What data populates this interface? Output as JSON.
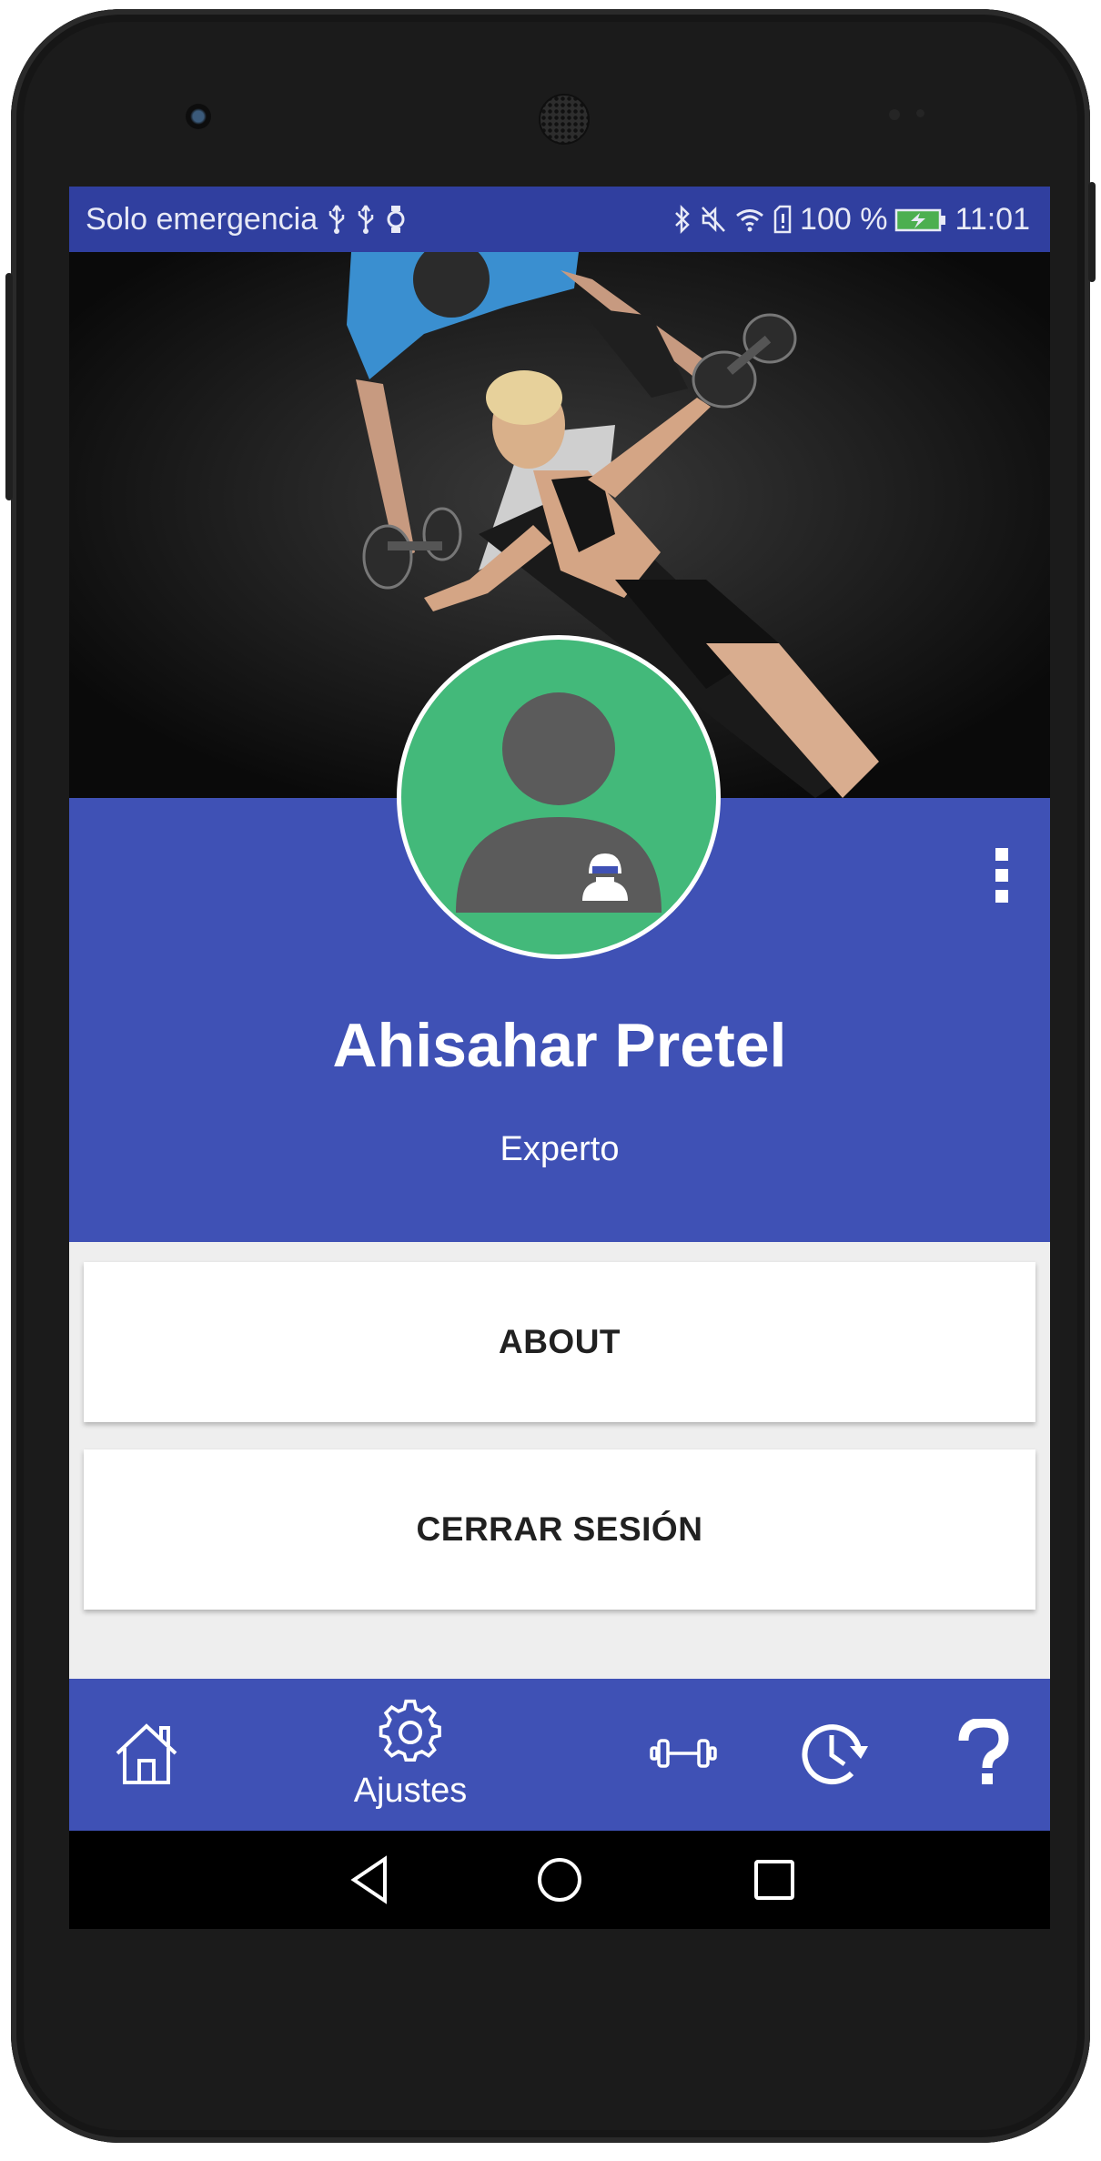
{
  "status_bar": {
    "carrier": "Solo emergencia",
    "battery": "100 %",
    "time": "11:01",
    "icons_left": [
      "usb-icon",
      "usb-icon",
      "watch-icon"
    ],
    "icons_right": [
      "bluetooth-icon",
      "mute-icon",
      "wifi-icon",
      "sd-card-icon",
      "battery-charging-icon"
    ]
  },
  "hero": {
    "image": "gym-workout-photo"
  },
  "profile": {
    "name": "Ahisahar Pretel",
    "role": "Experto",
    "avatar": "default-user-avatar",
    "actions": [
      "account-icon",
      "more-vert-icon"
    ]
  },
  "buttons": {
    "about": "ABOUT",
    "logout": "CERRAR SESIÓN"
  },
  "bottom_nav": {
    "items": [
      {
        "icon": "home-icon",
        "label": ""
      },
      {
        "icon": "gear-icon",
        "label": "Ajustes"
      },
      {
        "icon": "dumbbell-icon",
        "label": ""
      },
      {
        "icon": "history-icon",
        "label": ""
      },
      {
        "icon": "help-icon",
        "label": ""
      }
    ]
  },
  "colors": {
    "primary": "#3f51b5",
    "primary_dark": "#303f9f",
    "avatar_bg": "#43b97a",
    "content_bg": "#eeeeee"
  }
}
